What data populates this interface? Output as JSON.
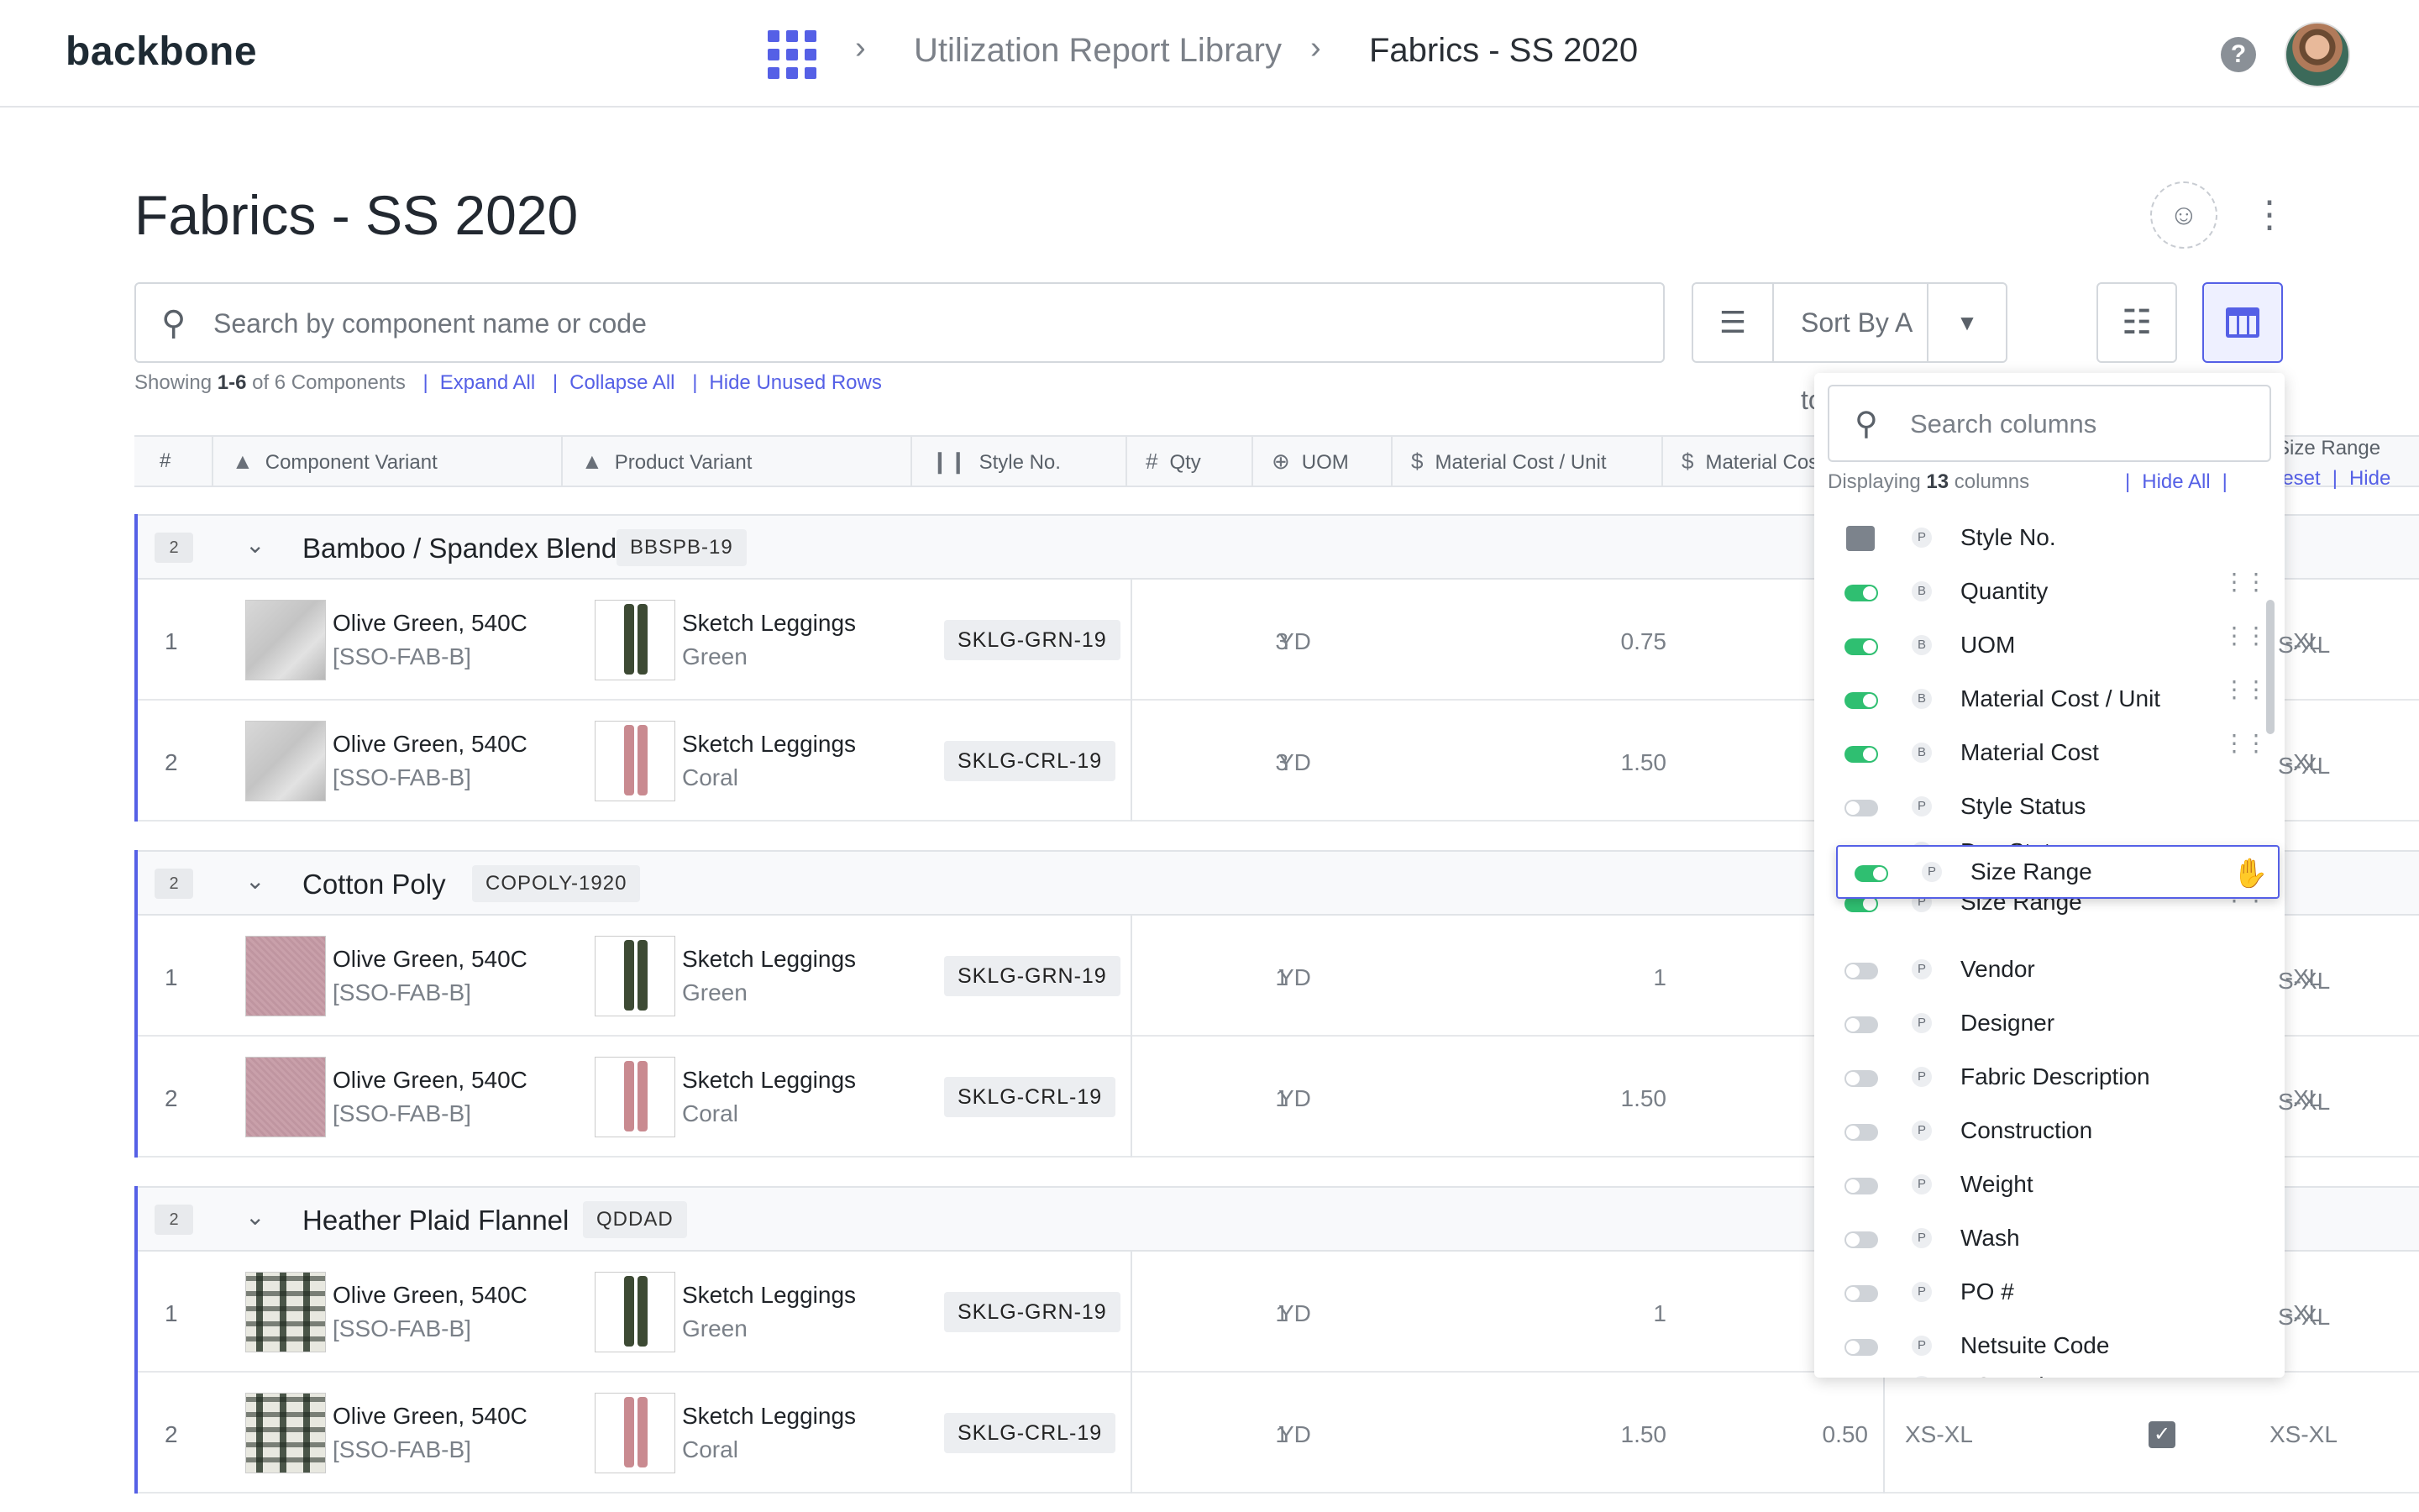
{
  "app": {
    "logo": "backbone",
    "breadcrumbs": [
      "Utilization Report Library",
      "Fabrics - SS 2020"
    ],
    "breadcrumb_sep": "›",
    "help_label": "?"
  },
  "page": {
    "title": "Fabrics - SS 2020",
    "search_placeholder": "Search by component name or code",
    "sort_label": "Sort By A to Z",
    "summary": {
      "prefix": "Showing ",
      "range": "1-6",
      "suffix": " of 6 Components",
      "links": [
        "Expand All",
        "Collapse All",
        "Hide Unused Rows"
      ]
    }
  },
  "table": {
    "columns": [
      "#",
      "Component Variant",
      "Product Variant",
      "Style No.",
      "Qty",
      "UOM",
      "Material Cost / Unit",
      "Material Cost",
      "Size Range"
    ],
    "groups": [
      {
        "count": "2",
        "name": "Bamboo / Spandex Blend",
        "code": "BBSPB-19",
        "rows": [
          {
            "num": "1",
            "fabric": "grey",
            "cv_name": "Olive Green, 540C",
            "cv_code": "[SSO-FAB-B]",
            "pv_name": "Sketch Leggings",
            "pv_color": "Green",
            "style": "SKLG-GRN-19",
            "qty": "3",
            "uom": "YD",
            "mcu": "0.75",
            "size": "S-XL"
          },
          {
            "num": "2",
            "fabric": "grey",
            "cv_name": "Olive Green, 540C",
            "cv_code": "[SSO-FAB-B]",
            "pv_name": "Sketch Leggings",
            "pv_color": "Coral",
            "style": "SKLG-CRL-19",
            "qty": "3",
            "uom": "YD",
            "mcu": "1.50",
            "size": "S-XL"
          }
        ]
      },
      {
        "count": "2",
        "name": "Cotton Poly",
        "code": "COPOLY-1920",
        "rows": [
          {
            "num": "1",
            "fabric": "pink",
            "cv_name": "Olive Green, 540C",
            "cv_code": "[SSO-FAB-B]",
            "pv_name": "Sketch Leggings",
            "pv_color": "Green",
            "style": "SKLG-GRN-19",
            "qty": "1",
            "uom": "YD",
            "mcu": "1",
            "size": "S-XL"
          },
          {
            "num": "2",
            "fabric": "pink",
            "cv_name": "Olive Green, 540C",
            "cv_code": "[SSO-FAB-B]",
            "pv_name": "Sketch Leggings",
            "pv_color": "Coral",
            "style": "SKLG-CRL-19",
            "qty": "1",
            "uom": "YD",
            "mcu": "1.50",
            "size": "S-XL"
          }
        ]
      },
      {
        "count": "2",
        "name": "Heather Plaid Flannel",
        "code": "QDDAD",
        "rows": [
          {
            "num": "1",
            "fabric": "plaid",
            "cv_name": "Olive Green, 540C",
            "cv_code": "[SSO-FAB-B]",
            "pv_name": "Sketch Leggings",
            "pv_color": "Green",
            "style": "SKLG-GRN-19",
            "qty": "1",
            "uom": "YD",
            "mcu": "1",
            "size": "S-XL"
          },
          {
            "num": "2",
            "fabric": "plaid",
            "cv_name": "Olive Green, 540C",
            "cv_code": "[SSO-FAB-B]",
            "pv_name": "Sketch Leggings",
            "pv_color": "Coral",
            "style": "SKLG-CRL-19",
            "qty": "1",
            "uom": "YD",
            "mcu": "1.50",
            "mc": "0.50",
            "size1": "XS-XL",
            "checked": true,
            "size": "XS-XL"
          }
        ]
      }
    ]
  },
  "column_panel": {
    "search_placeholder": "Search columns",
    "count_prefix": "Displaying ",
    "count_value": "13",
    "count_suffix": " columns",
    "actions": [
      "Hide All",
      "Reset",
      "Hide"
    ],
    "items": [
      {
        "label": "Style No.",
        "tag": "P",
        "state": "locked"
      },
      {
        "label": "Quantity",
        "tag": "B",
        "state": "on"
      },
      {
        "label": "UOM",
        "tag": "B",
        "state": "on"
      },
      {
        "label": "Material Cost / Unit",
        "tag": "B",
        "state": "on"
      },
      {
        "label": "Material Cost",
        "tag": "B",
        "state": "on"
      },
      {
        "label": "Style Status",
        "tag": "P",
        "state": "off"
      },
      {
        "label": "Dev Status",
        "tag": "P",
        "state": "off"
      },
      {
        "label": "Size Range",
        "tag": "P",
        "state": "on"
      },
      {
        "label": "Vendor",
        "tag": "P",
        "state": "off"
      },
      {
        "label": "Designer",
        "tag": "P",
        "state": "off"
      },
      {
        "label": "Fabric Description",
        "tag": "P",
        "state": "off"
      },
      {
        "label": "Construction",
        "tag": "P",
        "state": "off"
      },
      {
        "label": "Weight",
        "tag": "P",
        "state": "off"
      },
      {
        "label": "Wash",
        "tag": "P",
        "state": "off"
      },
      {
        "label": "PO #",
        "tag": "P",
        "state": "off"
      },
      {
        "label": "Netsuite Code",
        "tag": "P",
        "state": "off"
      },
      {
        "label": "FOB Price",
        "tag": "P",
        "state": "off"
      }
    ],
    "dragging": {
      "label": "Size Range",
      "tag": "P",
      "state": "on"
    }
  },
  "colors": {
    "accent": "#5560e6",
    "toggle_on": "#2fbf71",
    "toggle_off": "#cfd3d8"
  }
}
